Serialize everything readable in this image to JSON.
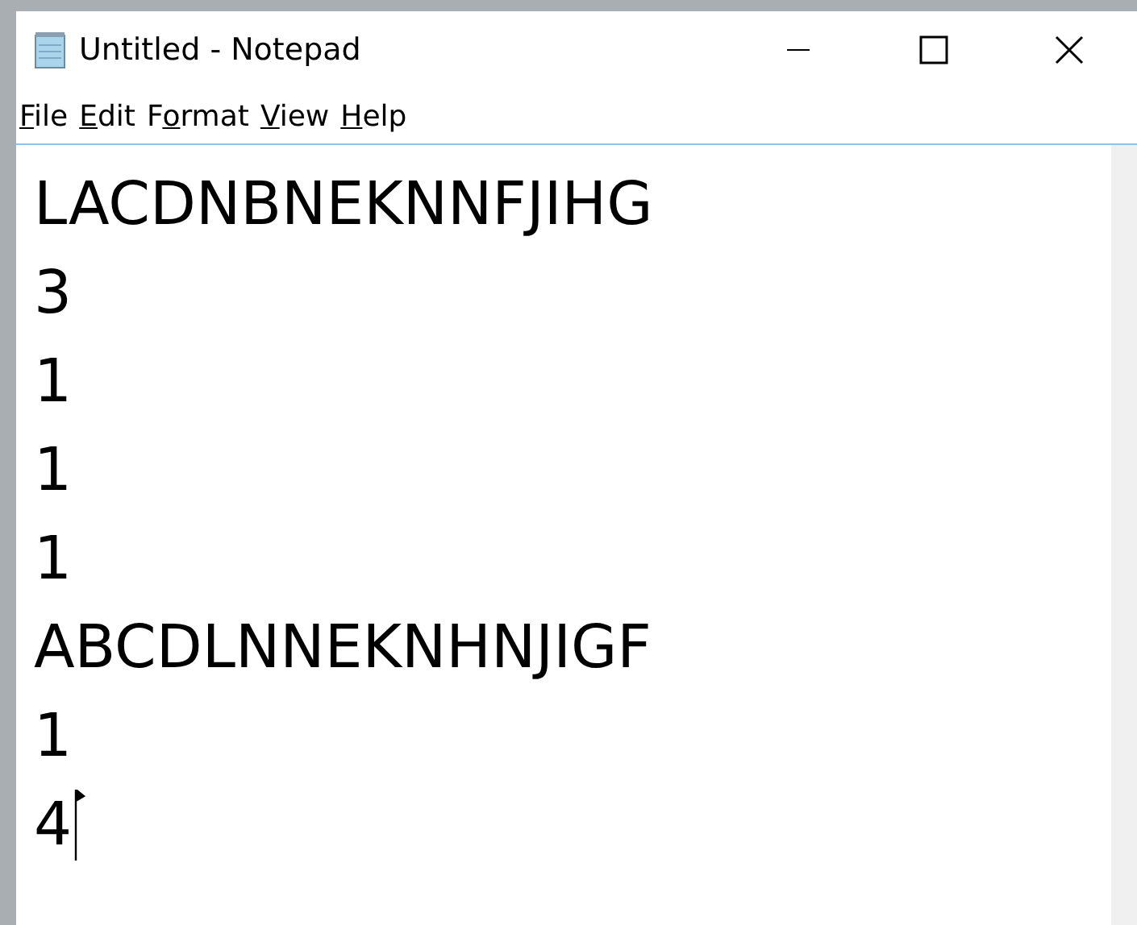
{
  "window": {
    "title": "Untitled - Notepad"
  },
  "menu": [
    {
      "key": "F",
      "post": "ile"
    },
    {
      "key": "E",
      "post": "dit"
    },
    {
      "pre": "F",
      "key": "o",
      "post": "rmat"
    },
    {
      "key": "V",
      "post": "iew"
    },
    {
      "key": "H",
      "post": "elp"
    }
  ],
  "editor": {
    "lines": [
      "LACDNBNEKNNFJIHG",
      "3",
      "1",
      "1",
      "1",
      "ABCDLNNEKNHNJIGF",
      "1",
      "4"
    ]
  }
}
